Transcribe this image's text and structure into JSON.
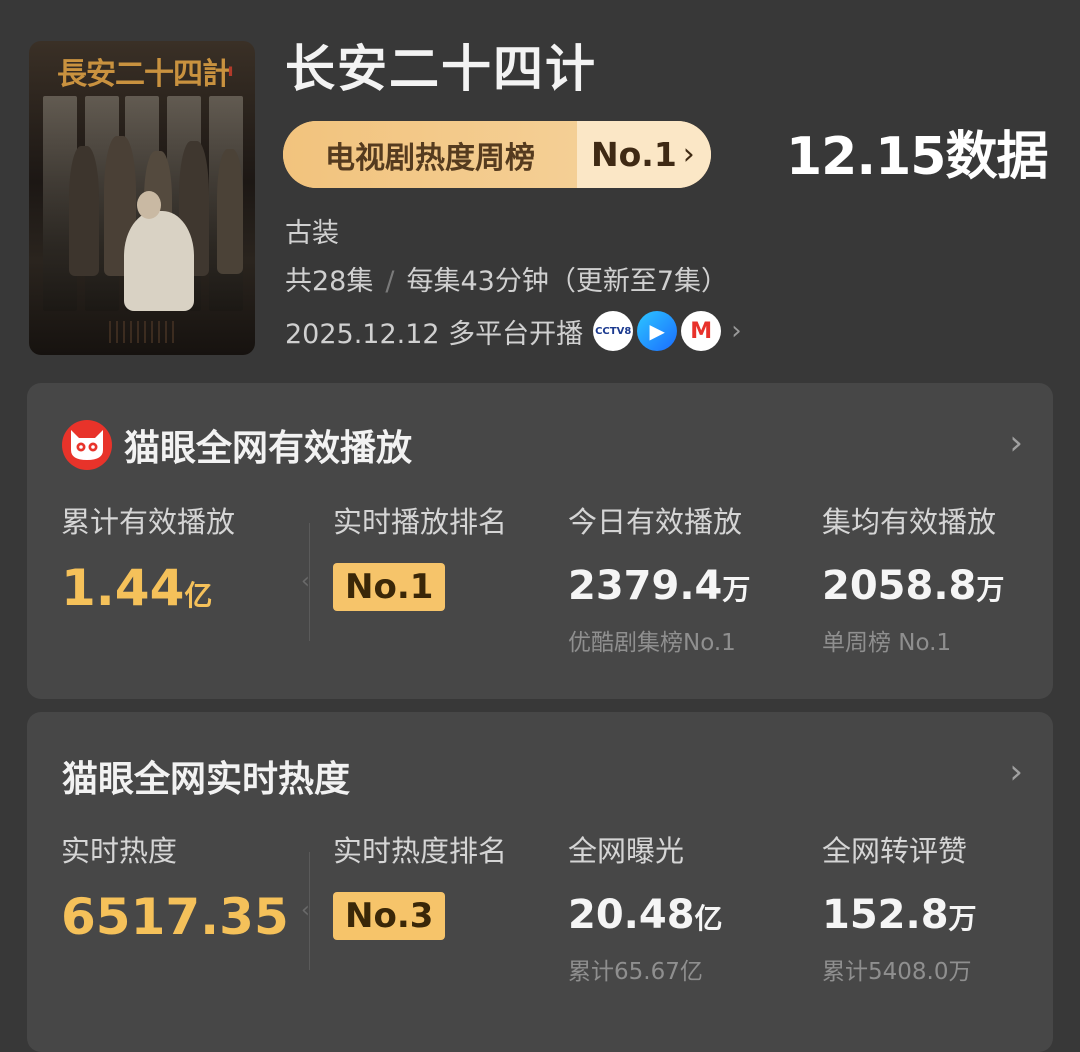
{
  "show": {
    "poster_title": "長安二十四計",
    "title": "长安二十四计",
    "rank_label": "电视剧热度周榜",
    "rank_value": "No.1",
    "date_badge": "12.15数据",
    "genre": "古装",
    "episodes": "共28集",
    "duration": "每集43分钟（更新至7集）",
    "release": "2025.12.12 多平台开播",
    "platforms": [
      {
        "name": "cctv8",
        "label": "CCTV8"
      },
      {
        "name": "youku",
        "label": "▶"
      },
      {
        "name": "mgtv",
        "label": "M"
      }
    ]
  },
  "card1": {
    "title": "猫眼全网有效播放",
    "stats": [
      {
        "label": "累计有效播放",
        "value": "1.44",
        "unit": "亿"
      },
      {
        "label": "实时播放排名",
        "rank": "No.1"
      },
      {
        "label": "今日有效播放",
        "value": "2379.4",
        "unit": "万",
        "sub": "优酷剧集榜No.1"
      },
      {
        "label": "集均有效播放",
        "value": "2058.8",
        "unit": "万",
        "sub": "单周榜 No.1"
      }
    ]
  },
  "card2": {
    "title": "猫眼全网实时热度",
    "stats": [
      {
        "label": "实时热度",
        "value": "6517.35"
      },
      {
        "label": "实时热度排名",
        "rank": "No.3"
      },
      {
        "label": "全网曝光",
        "value": "20.48",
        "unit": "亿",
        "sub": "累计65.67亿"
      },
      {
        "label": "全网转评赞",
        "value": "152.8",
        "unit": "万",
        "sub": "累计5408.0万"
      }
    ]
  },
  "colors": {
    "accent_gold": "#f5c15a",
    "card_bg": "#474747",
    "page_bg": "#383838"
  }
}
